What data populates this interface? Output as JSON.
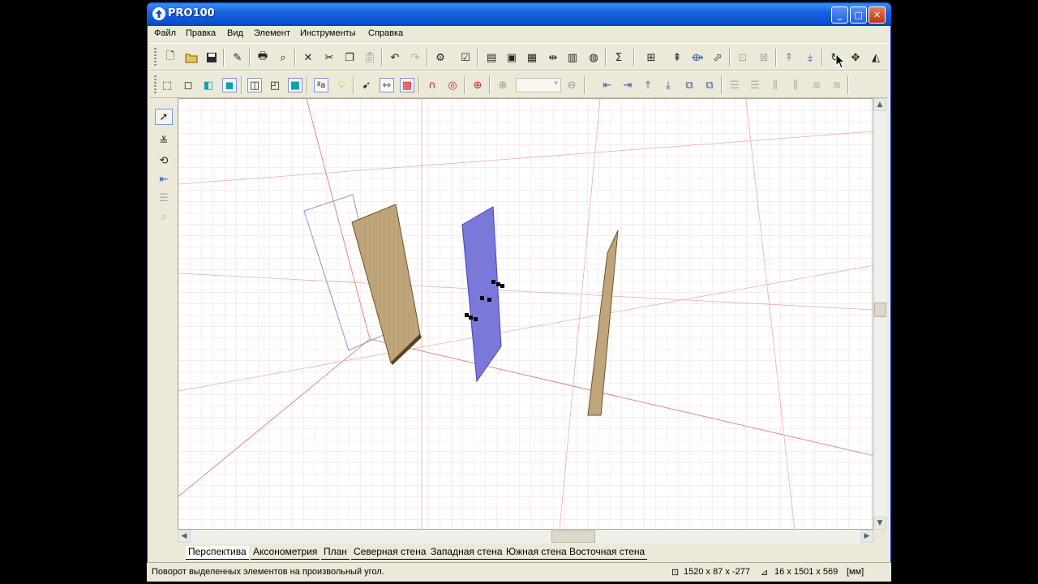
{
  "window": {
    "title": "PRO100",
    "controls": {
      "minimize": "_",
      "maximize": "□",
      "close": "✕"
    }
  },
  "menu": {
    "items": [
      "Файл",
      "Правка",
      "Вид",
      "Элемент",
      "Инструменты",
      "Справка"
    ]
  },
  "toolbar1": {
    "icons": [
      "new-file-icon",
      "open-folder-icon",
      "save-icon",
      "properties-icon",
      "print-icon",
      "print-preview-icon",
      "delete-icon",
      "cut-icon",
      "copy-icon",
      "paste-icon",
      "undo-icon",
      "redo-icon",
      "element-settings-icon",
      "checklist-icon",
      "view-1-icon",
      "view-2-icon",
      "view-3-icon",
      "view-4-icon",
      "view-5-icon",
      "view-6-icon",
      "sum-icon",
      "grid-snap-icon",
      "rotate-axis-1-icon",
      "rotate-axis-2-icon",
      "rotate-axis-3-icon",
      "group-icon",
      "ungroup-icon",
      "rotate-x-icon",
      "rotate-y-icon",
      "rotate-free-icon",
      "move-icon",
      "mirror-icon"
    ]
  },
  "toolbar2": {
    "icons": [
      "cube-wire-icon",
      "cube-outline-icon",
      "cube-shaded-icon",
      "cube-solid-icon",
      "cube-edge-icon",
      "cube-hidden-icon",
      "cube-color-icon",
      "text-aa-icon",
      "light-bulb-icon",
      "arrow-icon",
      "dimension-icon",
      "grid-icon",
      "magnet-icon",
      "target-icon",
      "crosshair-icon",
      "zoom-in-icon",
      "zoom-out-icon",
      "align-left-icon",
      "align-right-icon",
      "align-top-icon",
      "align-bottom-icon",
      "layers-1-icon",
      "layers-2-icon",
      "distribute-1-icon",
      "distribute-2-icon",
      "distribute-3-icon",
      "distribute-4-icon",
      "distribute-5-icon",
      "distribute-6-icon"
    ],
    "zoom_value": ""
  },
  "left_tools": [
    "select-arrow-icon",
    "trim-icon",
    "rotate-tool-icon",
    "align-tool-icon",
    "distribute-tool-icon",
    "zoom-tool-icon"
  ],
  "colors": {
    "titlebar": "#0b4fd0",
    "panel_wood": "#bfa57a",
    "panel_selected": "#7a78d8",
    "grid_line": "#f0b8b8"
  },
  "tabs": [
    "Перспектива",
    "Аксонометрия",
    "План",
    "Северная стена",
    "Западная стена",
    "Южная стена",
    "Восточная стена"
  ],
  "status": {
    "message": "Поворот выделенных элементов на  произвольный угол.",
    "size1": "1520 x 87 x -277",
    "size2": "16 x 1501 x 569",
    "units": "[мм]"
  }
}
